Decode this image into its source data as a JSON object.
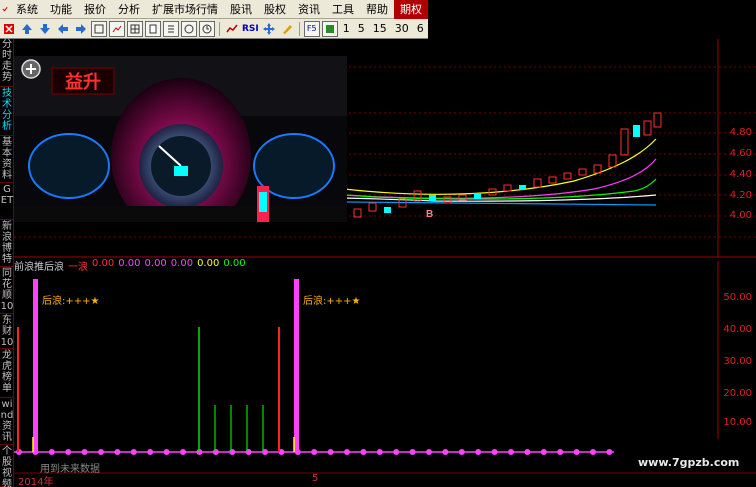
{
  "menu": {
    "items": [
      "系统",
      "功能",
      "报价",
      "分析",
      "扩展市场行情",
      "股讯",
      "股权",
      "资讯",
      "工具",
      "帮助"
    ],
    "active": "期权"
  },
  "toolbar": {
    "numbers": [
      "1",
      "5",
      "15",
      "30",
      "6"
    ],
    "rsi_label": "RSI",
    "f5_label": "F5"
  },
  "left_tabs": [
    {
      "label": "分时走势",
      "selected": false
    },
    {
      "label": "技术分析",
      "selected": true
    },
    {
      "label": "基本资料",
      "selected": false
    },
    {
      "label": "GET",
      "selected": false
    },
    {
      "label": "新浪博特",
      "selected": false
    },
    {
      "label": "同花顺10",
      "selected": false
    },
    {
      "label": "东财10",
      "selected": false
    },
    {
      "label": "龙虎榜单",
      "selected": false
    },
    {
      "label": "wind资讯",
      "selected": false
    },
    {
      "label": "个股视频",
      "selected": false
    }
  ],
  "banner": {
    "logo_text": "益升"
  },
  "upper_axis": {
    "ticks": [
      "4.80",
      "4.60",
      "4.40",
      "4.20",
      "4.00"
    ]
  },
  "upper_markers": {
    "b_label": "B"
  },
  "lower_panel": {
    "title": "前浪推后浪",
    "series_label": "一浪",
    "values": [
      "0.00",
      "0.00",
      "0.00",
      "0.00",
      "0.00",
      "0.00"
    ],
    "value_colors": [
      "#ff3030",
      "#ff40ff",
      "#ff40ff",
      "#ff40ff",
      "#ffff00",
      "#00ff00"
    ],
    "annot": "后浪:+++★",
    "ticks": [
      "50.00",
      "40.00",
      "30.00",
      "20.00",
      "10.00"
    ]
  },
  "footer": {
    "future_text": "用到未来数据",
    "year_label": "2014年",
    "month_label": "5",
    "watermark": "www.7gpzb.com"
  },
  "colors": {
    "grid": "#7a0000",
    "axis_text": "#e02020",
    "accent": "#b00000"
  }
}
